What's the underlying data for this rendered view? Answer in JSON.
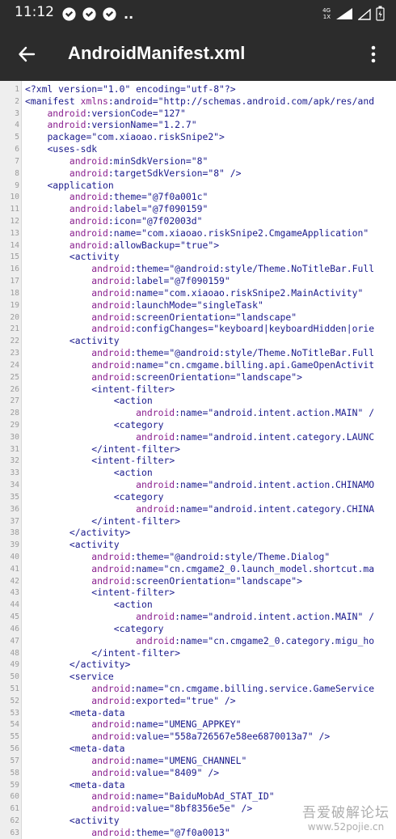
{
  "status_bar": {
    "time": "11:12",
    "overflow": "..",
    "network_top": "4G",
    "network_bottom": "1X"
  },
  "app_bar": {
    "title": "AndroidManifest.xml"
  },
  "code_lines": [
    {
      "n": "1",
      "indent": 0,
      "tokens": [
        [
          "punct",
          "<?"
        ],
        [
          "tag",
          "xml"
        ],
        [
          "attr",
          " version="
        ],
        [
          "val",
          "\"1.0\""
        ],
        [
          "attr",
          " encoding="
        ],
        [
          "val",
          "\"utf-8\""
        ],
        [
          "punct",
          "?>"
        ]
      ]
    },
    {
      "n": "2",
      "indent": 0,
      "tokens": [
        [
          "punct",
          "<"
        ],
        [
          "tag",
          "manifest"
        ],
        [
          "ns",
          " xmlns"
        ],
        [
          "punct",
          ":"
        ],
        [
          "attr",
          "android="
        ],
        [
          "val",
          "\"http://schemas.android.com/apk/res/and"
        ]
      ]
    },
    {
      "n": "3",
      "indent": 4,
      "tokens": [
        [
          "ns",
          "android"
        ],
        [
          "punct",
          ":"
        ],
        [
          "attr",
          "versionCode="
        ],
        [
          "val",
          "\"127\""
        ]
      ]
    },
    {
      "n": "4",
      "indent": 4,
      "tokens": [
        [
          "ns",
          "android"
        ],
        [
          "punct",
          ":"
        ],
        [
          "attr",
          "versionName="
        ],
        [
          "val",
          "\"1.2.7\""
        ]
      ]
    },
    {
      "n": "5",
      "indent": 4,
      "tokens": [
        [
          "attr",
          "package="
        ],
        [
          "val",
          "\"com.xiaoao.riskSnipe2\""
        ],
        [
          "punct",
          ">"
        ]
      ]
    },
    {
      "n": "6",
      "indent": 4,
      "tokens": [
        [
          "punct",
          "<"
        ],
        [
          "tag",
          "uses-sdk"
        ]
      ]
    },
    {
      "n": "7",
      "indent": 8,
      "tokens": [
        [
          "ns",
          "android"
        ],
        [
          "punct",
          ":"
        ],
        [
          "attr",
          "minSdkVersion="
        ],
        [
          "val",
          "\"8\""
        ]
      ]
    },
    {
      "n": "8",
      "indent": 8,
      "tokens": [
        [
          "ns",
          "android"
        ],
        [
          "punct",
          ":"
        ],
        [
          "attr",
          "targetSdkVersion="
        ],
        [
          "val",
          "\"8\""
        ],
        [
          "punct",
          " />"
        ]
      ]
    },
    {
      "n": "9",
      "indent": 4,
      "tokens": [
        [
          "punct",
          "<"
        ],
        [
          "tag",
          "application"
        ]
      ]
    },
    {
      "n": "10",
      "indent": 8,
      "tokens": [
        [
          "ns",
          "android"
        ],
        [
          "punct",
          ":"
        ],
        [
          "attr",
          "theme="
        ],
        [
          "val",
          "\"@7f0a001c\""
        ]
      ]
    },
    {
      "n": "11",
      "indent": 8,
      "tokens": [
        [
          "ns",
          "android"
        ],
        [
          "punct",
          ":"
        ],
        [
          "attr",
          "label="
        ],
        [
          "val",
          "\"@7f090159\""
        ]
      ]
    },
    {
      "n": "12",
      "indent": 8,
      "tokens": [
        [
          "ns",
          "android"
        ],
        [
          "punct",
          ":"
        ],
        [
          "attr",
          "icon="
        ],
        [
          "val",
          "\"@7f02003d\""
        ]
      ]
    },
    {
      "n": "13",
      "indent": 8,
      "tokens": [
        [
          "ns",
          "android"
        ],
        [
          "punct",
          ":"
        ],
        [
          "attr",
          "name="
        ],
        [
          "val",
          "\"com.xiaoao.riskSnipe2.CmgameApplication\""
        ]
      ]
    },
    {
      "n": "14",
      "indent": 8,
      "tokens": [
        [
          "ns",
          "android"
        ],
        [
          "punct",
          ":"
        ],
        [
          "attr",
          "allowBackup="
        ],
        [
          "val",
          "\"true\""
        ],
        [
          "punct",
          ">"
        ]
      ]
    },
    {
      "n": "15",
      "indent": 8,
      "tokens": [
        [
          "punct",
          "<"
        ],
        [
          "tag",
          "activity"
        ]
      ]
    },
    {
      "n": "16",
      "indent": 12,
      "tokens": [
        [
          "ns",
          "android"
        ],
        [
          "punct",
          ":"
        ],
        [
          "attr",
          "theme="
        ],
        [
          "val",
          "\"@android:style/Theme.NoTitleBar.Full"
        ]
      ]
    },
    {
      "n": "17",
      "indent": 12,
      "tokens": [
        [
          "ns",
          "android"
        ],
        [
          "punct",
          ":"
        ],
        [
          "attr",
          "label="
        ],
        [
          "val",
          "\"@7f090159\""
        ]
      ]
    },
    {
      "n": "18",
      "indent": 12,
      "tokens": [
        [
          "ns",
          "android"
        ],
        [
          "punct",
          ":"
        ],
        [
          "attr",
          "name="
        ],
        [
          "val",
          "\"com.xiaoao.riskSnipe2.MainActivity\""
        ]
      ]
    },
    {
      "n": "19",
      "indent": 12,
      "tokens": [
        [
          "ns",
          "android"
        ],
        [
          "punct",
          ":"
        ],
        [
          "attr",
          "launchMode="
        ],
        [
          "val",
          "\"singleTask\""
        ]
      ]
    },
    {
      "n": "20",
      "indent": 12,
      "tokens": [
        [
          "ns",
          "android"
        ],
        [
          "punct",
          ":"
        ],
        [
          "attr",
          "screenOrientation="
        ],
        [
          "val",
          "\"landscape\""
        ]
      ]
    },
    {
      "n": "21",
      "indent": 12,
      "tokens": [
        [
          "ns",
          "android"
        ],
        [
          "punct",
          ":"
        ],
        [
          "attr",
          "configChanges="
        ],
        [
          "val",
          "\"keyboard|keyboardHidden|orie"
        ]
      ]
    },
    {
      "n": "22",
      "indent": 8,
      "tokens": [
        [
          "punct",
          "<"
        ],
        [
          "tag",
          "activity"
        ]
      ]
    },
    {
      "n": "23",
      "indent": 12,
      "tokens": [
        [
          "ns",
          "android"
        ],
        [
          "punct",
          ":"
        ],
        [
          "attr",
          "theme="
        ],
        [
          "val",
          "\"@android:style/Theme.NoTitleBar.Full"
        ]
      ]
    },
    {
      "n": "24",
      "indent": 12,
      "tokens": [
        [
          "ns",
          "android"
        ],
        [
          "punct",
          ":"
        ],
        [
          "attr",
          "name="
        ],
        [
          "val",
          "\"cn.cmgame.billing.api.GameOpenActivit"
        ]
      ]
    },
    {
      "n": "25",
      "indent": 12,
      "tokens": [
        [
          "ns",
          "android"
        ],
        [
          "punct",
          ":"
        ],
        [
          "attr",
          "screenOrientation="
        ],
        [
          "val",
          "\"landscape\""
        ],
        [
          "punct",
          ">"
        ]
      ]
    },
    {
      "n": "26",
      "indent": 12,
      "tokens": [
        [
          "punct",
          "<"
        ],
        [
          "tag",
          "intent-filter"
        ],
        [
          "punct",
          ">"
        ]
      ]
    },
    {
      "n": "27",
      "indent": 16,
      "tokens": [
        [
          "punct",
          "<"
        ],
        [
          "tag",
          "action"
        ]
      ]
    },
    {
      "n": "28",
      "indent": 20,
      "tokens": [
        [
          "ns",
          "android"
        ],
        [
          "punct",
          ":"
        ],
        [
          "attr",
          "name="
        ],
        [
          "val",
          "\"android.intent.action.MAIN\""
        ],
        [
          "punct",
          " /"
        ]
      ]
    },
    {
      "n": "29",
      "indent": 16,
      "tokens": [
        [
          "punct",
          "<"
        ],
        [
          "tag",
          "category"
        ]
      ]
    },
    {
      "n": "30",
      "indent": 20,
      "tokens": [
        [
          "ns",
          "android"
        ],
        [
          "punct",
          ":"
        ],
        [
          "attr",
          "name="
        ],
        [
          "val",
          "\"android.intent.category.LAUNC"
        ]
      ]
    },
    {
      "n": "31",
      "indent": 12,
      "tokens": [
        [
          "punct",
          "</"
        ],
        [
          "tag",
          "intent-filter"
        ],
        [
          "punct",
          ">"
        ]
      ]
    },
    {
      "n": "32",
      "indent": 12,
      "tokens": [
        [
          "punct",
          "<"
        ],
        [
          "tag",
          "intent-filter"
        ],
        [
          "punct",
          ">"
        ]
      ]
    },
    {
      "n": "33",
      "indent": 16,
      "tokens": [
        [
          "punct",
          "<"
        ],
        [
          "tag",
          "action"
        ]
      ]
    },
    {
      "n": "34",
      "indent": 20,
      "tokens": [
        [
          "ns",
          "android"
        ],
        [
          "punct",
          ":"
        ],
        [
          "attr",
          "name="
        ],
        [
          "val",
          "\"android.intent.action.CHINAMO"
        ]
      ]
    },
    {
      "n": "35",
      "indent": 16,
      "tokens": [
        [
          "punct",
          "<"
        ],
        [
          "tag",
          "category"
        ]
      ]
    },
    {
      "n": "36",
      "indent": 20,
      "tokens": [
        [
          "ns",
          "android"
        ],
        [
          "punct",
          ":"
        ],
        [
          "attr",
          "name="
        ],
        [
          "val",
          "\"android.intent.category.CHINA"
        ]
      ]
    },
    {
      "n": "37",
      "indent": 12,
      "tokens": [
        [
          "punct",
          "</"
        ],
        [
          "tag",
          "intent-filter"
        ],
        [
          "punct",
          ">"
        ]
      ]
    },
    {
      "n": "38",
      "indent": 8,
      "tokens": [
        [
          "punct",
          "</"
        ],
        [
          "tag",
          "activity"
        ],
        [
          "punct",
          ">"
        ]
      ]
    },
    {
      "n": "39",
      "indent": 8,
      "tokens": [
        [
          "punct",
          "<"
        ],
        [
          "tag",
          "activity"
        ]
      ]
    },
    {
      "n": "40",
      "indent": 12,
      "tokens": [
        [
          "ns",
          "android"
        ],
        [
          "punct",
          ":"
        ],
        [
          "attr",
          "theme="
        ],
        [
          "val",
          "\"@android:style/Theme.Dialog\""
        ]
      ]
    },
    {
      "n": "41",
      "indent": 12,
      "tokens": [
        [
          "ns",
          "android"
        ],
        [
          "punct",
          ":"
        ],
        [
          "attr",
          "name="
        ],
        [
          "val",
          "\"cn.cmgame2_0.launch_model.shortcut.ma"
        ]
      ]
    },
    {
      "n": "42",
      "indent": 12,
      "tokens": [
        [
          "ns",
          "android"
        ],
        [
          "punct",
          ":"
        ],
        [
          "attr",
          "screenOrientation="
        ],
        [
          "val",
          "\"landscape\""
        ],
        [
          "punct",
          ">"
        ]
      ]
    },
    {
      "n": "43",
      "indent": 12,
      "tokens": [
        [
          "punct",
          "<"
        ],
        [
          "tag",
          "intent-filter"
        ],
        [
          "punct",
          ">"
        ]
      ]
    },
    {
      "n": "44",
      "indent": 16,
      "tokens": [
        [
          "punct",
          "<"
        ],
        [
          "tag",
          "action"
        ]
      ]
    },
    {
      "n": "45",
      "indent": 20,
      "tokens": [
        [
          "ns",
          "android"
        ],
        [
          "punct",
          ":"
        ],
        [
          "attr",
          "name="
        ],
        [
          "val",
          "\"android.intent.action.MAIN\""
        ],
        [
          "punct",
          " /"
        ]
      ]
    },
    {
      "n": "46",
      "indent": 16,
      "tokens": [
        [
          "punct",
          "<"
        ],
        [
          "tag",
          "category"
        ]
      ]
    },
    {
      "n": "47",
      "indent": 20,
      "tokens": [
        [
          "ns",
          "android"
        ],
        [
          "punct",
          ":"
        ],
        [
          "attr",
          "name="
        ],
        [
          "val",
          "\"cn.cmgame2_0.category.migu_ho"
        ]
      ]
    },
    {
      "n": "48",
      "indent": 12,
      "tokens": [
        [
          "punct",
          "</"
        ],
        [
          "tag",
          "intent-filter"
        ],
        [
          "punct",
          ">"
        ]
      ]
    },
    {
      "n": "49",
      "indent": 8,
      "tokens": [
        [
          "punct",
          "</"
        ],
        [
          "tag",
          "activity"
        ],
        [
          "punct",
          ">"
        ]
      ]
    },
    {
      "n": "50",
      "indent": 8,
      "tokens": [
        [
          "punct",
          "<"
        ],
        [
          "tag",
          "service"
        ]
      ]
    },
    {
      "n": "51",
      "indent": 12,
      "tokens": [
        [
          "ns",
          "android"
        ],
        [
          "punct",
          ":"
        ],
        [
          "attr",
          "name="
        ],
        [
          "val",
          "\"cn.cmgame.billing.service.GameService"
        ]
      ]
    },
    {
      "n": "52",
      "indent": 12,
      "tokens": [
        [
          "ns",
          "android"
        ],
        [
          "punct",
          ":"
        ],
        [
          "attr",
          "exported="
        ],
        [
          "val",
          "\"true\""
        ],
        [
          "punct",
          " />"
        ]
      ]
    },
    {
      "n": "53",
      "indent": 8,
      "tokens": [
        [
          "punct",
          "<"
        ],
        [
          "tag",
          "meta-data"
        ]
      ]
    },
    {
      "n": "54",
      "indent": 12,
      "tokens": [
        [
          "ns",
          "android"
        ],
        [
          "punct",
          ":"
        ],
        [
          "attr",
          "name="
        ],
        [
          "val",
          "\"UMENG_APPKEY\""
        ]
      ]
    },
    {
      "n": "55",
      "indent": 12,
      "tokens": [
        [
          "ns",
          "android"
        ],
        [
          "punct",
          ":"
        ],
        [
          "attr",
          "value="
        ],
        [
          "val",
          "\"558a726567e58ee6870013a7\""
        ],
        [
          "punct",
          " />"
        ]
      ]
    },
    {
      "n": "56",
      "indent": 8,
      "tokens": [
        [
          "punct",
          "<"
        ],
        [
          "tag",
          "meta-data"
        ]
      ]
    },
    {
      "n": "57",
      "indent": 12,
      "tokens": [
        [
          "ns",
          "android"
        ],
        [
          "punct",
          ":"
        ],
        [
          "attr",
          "name="
        ],
        [
          "val",
          "\"UMENG_CHANNEL\""
        ]
      ]
    },
    {
      "n": "58",
      "indent": 12,
      "tokens": [
        [
          "ns",
          "android"
        ],
        [
          "punct",
          ":"
        ],
        [
          "attr",
          "value="
        ],
        [
          "val",
          "\"8409\""
        ],
        [
          "punct",
          " />"
        ]
      ]
    },
    {
      "n": "59",
      "indent": 8,
      "tokens": [
        [
          "punct",
          "<"
        ],
        [
          "tag",
          "meta-data"
        ]
      ]
    },
    {
      "n": "60",
      "indent": 12,
      "tokens": [
        [
          "ns",
          "android"
        ],
        [
          "punct",
          ":"
        ],
        [
          "attr",
          "name="
        ],
        [
          "val",
          "\"BaiduMobAd_STAT_ID\""
        ]
      ]
    },
    {
      "n": "61",
      "indent": 12,
      "tokens": [
        [
          "ns",
          "android"
        ],
        [
          "punct",
          ":"
        ],
        [
          "attr",
          "value="
        ],
        [
          "val",
          "\"8bf8356e5e\""
        ],
        [
          "punct",
          " />"
        ]
      ]
    },
    {
      "n": "62",
      "indent": 8,
      "tokens": [
        [
          "punct",
          "<"
        ],
        [
          "tag",
          "activity"
        ]
      ]
    },
    {
      "n": "63",
      "indent": 12,
      "tokens": [
        [
          "ns",
          "android"
        ],
        [
          "punct",
          ":"
        ],
        [
          "attr",
          "theme="
        ],
        [
          "val",
          "\"@7f0a0013\""
        ]
      ]
    }
  ],
  "watermark": {
    "title": "吾爱破解论坛",
    "url": "www.52pojie.cn"
  }
}
